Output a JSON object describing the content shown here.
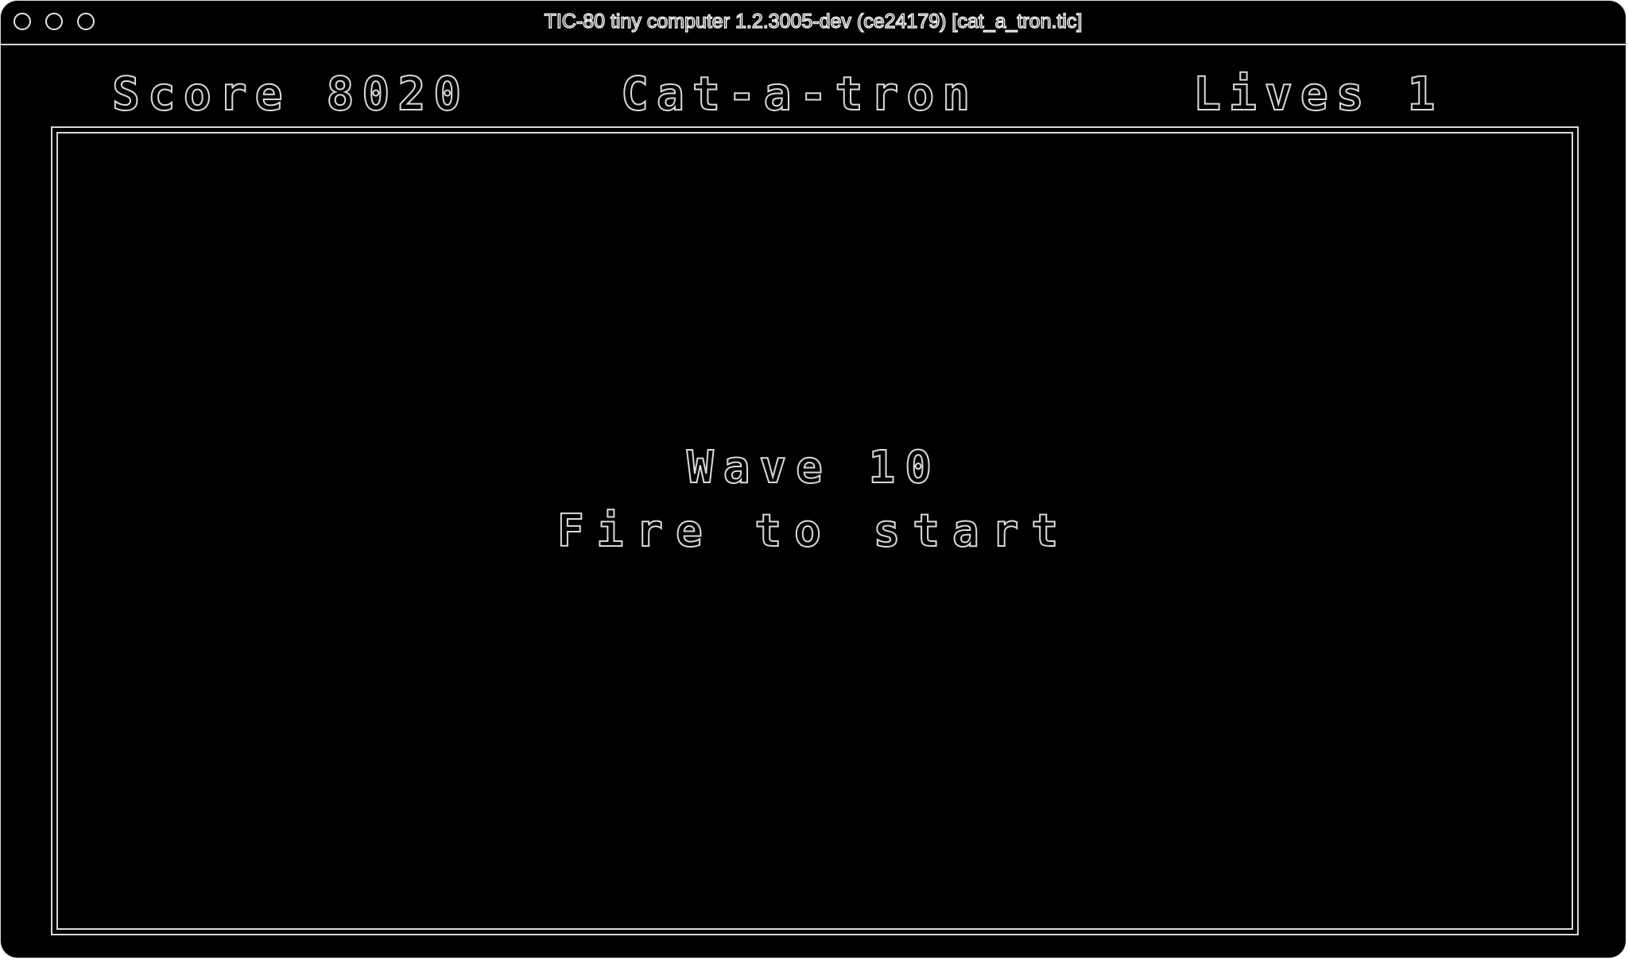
{
  "window": {
    "title": "TIC-80 tiny computer 1.2.3005-dev (ce24179) [cat_a_tron.tic]"
  },
  "hud": {
    "score": "Score 8020",
    "title": "Cat-a-tron",
    "lives": "Lives 1"
  },
  "screen": {
    "wave": "Wave 10",
    "prompt": "Fire to start"
  },
  "colors": {
    "background": "#000000",
    "outline": "#d9d9d9"
  }
}
